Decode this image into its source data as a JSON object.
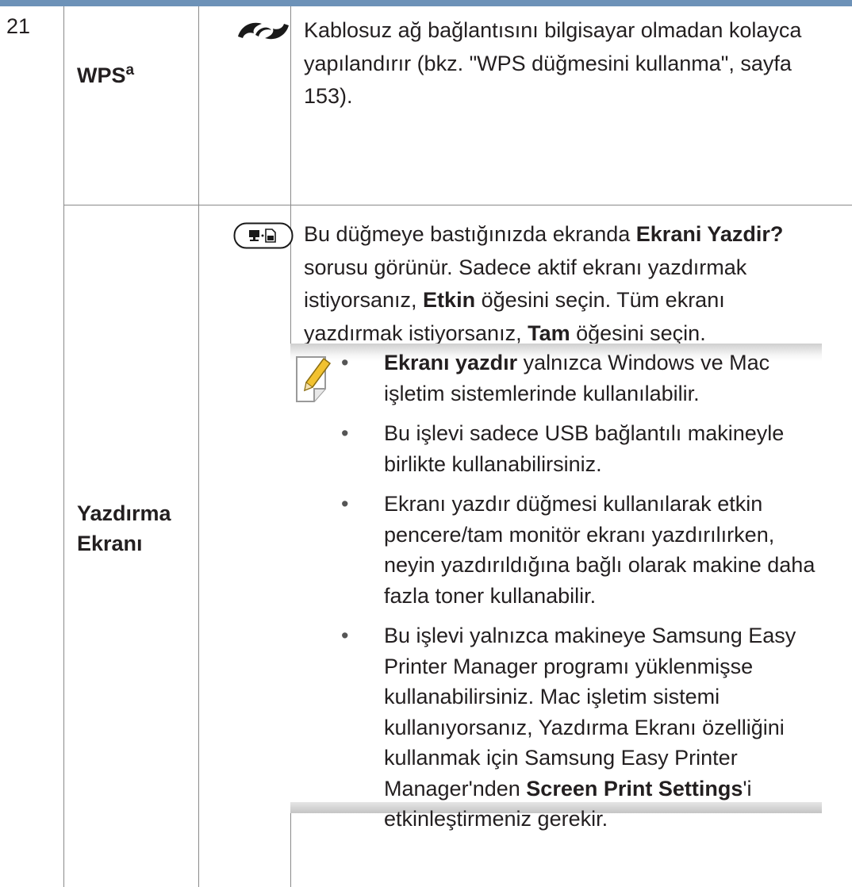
{
  "table": {
    "row_number": "21",
    "row_wps": {
      "label": "WPS",
      "label_sup": "a",
      "icon": "wps-button-icon",
      "description": "Kablosuz ağ bağlantısını bilgisayar olmadan kolayca yapılandırır (bkz. \"WPS düğmesini kullanma\", sayfa 153)."
    },
    "row_print_screen": {
      "label_line1": "Yazdırma",
      "label_line2": "Ekranı",
      "icon": "print-screen-button-icon",
      "desc_part1": "Bu düğmeye bastığınızda ekranda ",
      "desc_bold1": "Ekrani Yazdir?",
      "desc_part2": " sorusu görünür. Sadece aktif ekranı yazdırmak istiyorsanız, ",
      "desc_bold2": "Etkin",
      "desc_part3": " öğesini seçin. Tüm ekranı yazdırmak istiyorsanız, ",
      "desc_bold3": "Tam",
      "desc_part4": " öğesini seçin.",
      "note": {
        "icon": "note-pencil-icon",
        "bullet_char": "•",
        "b1_bold": "Ekranı yazdır",
        "b1_text": " yalnızca Windows ve Mac işletim sistemlerinde kullanılabilir.",
        "b2_text": "Bu işlevi sadece USB bağlantılı makineyle birlikte kullanabilirsiniz.",
        "b3_text": "Ekranı yazdır düğmesi kullanılarak etkin pencere/tam monitör ekranı yazdırılırken, neyin yazdırıldığına bağlı olarak makine daha fazla toner kullanabilir.",
        "b4_text1": "Bu işlevi yalnızca makineye Samsung Easy Printer Manager programı yüklenmişse kullanabilirsiniz. Mac işletim sistemi kullanıyorsanız, Yazdırma Ekranı özelliğini kullanmak için Samsung Easy Printer Manager'nden ",
        "b4_bold": "Screen Print Settings",
        "b4_text2": "'i etkinleştirmeniz gerekir."
      }
    }
  },
  "colors": {
    "header_bar": "#6d92b8",
    "rule": "#8a8a8a",
    "text": "#231f20"
  }
}
